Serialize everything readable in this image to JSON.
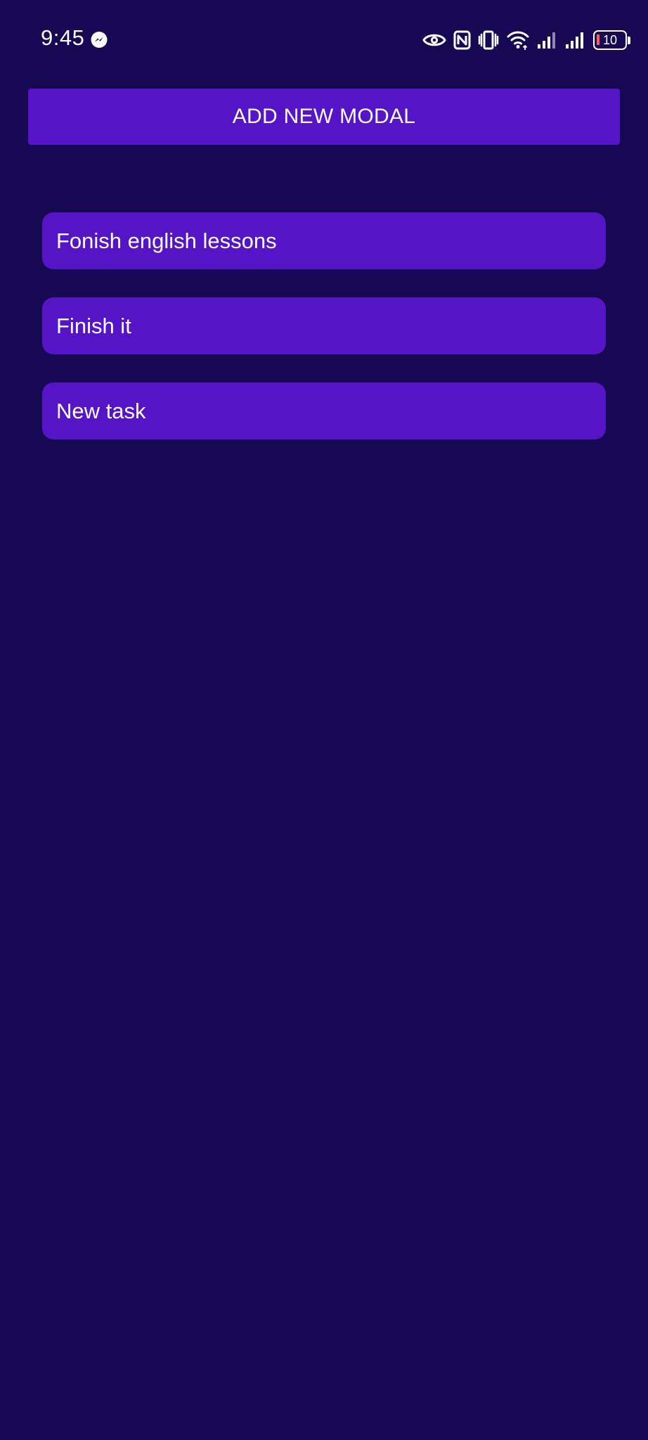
{
  "status_bar": {
    "time": "9:45",
    "battery_level": "10",
    "icons": [
      "messenger-icon",
      "eye-icon",
      "nfc-icon",
      "vibrate-icon",
      "wifi-icon",
      "signal-icon",
      "signal-icon",
      "battery-icon"
    ]
  },
  "actions": {
    "add_button_label": "ADD NEW MODAL"
  },
  "tasks": [
    {
      "label": "Fonish english lessons"
    },
    {
      "label": "Finish it"
    },
    {
      "label": "New task"
    }
  ],
  "colors": {
    "background": "#170854",
    "accent": "#5514c6",
    "text": "#ffffff",
    "battery_low": "#ff5a5a"
  }
}
